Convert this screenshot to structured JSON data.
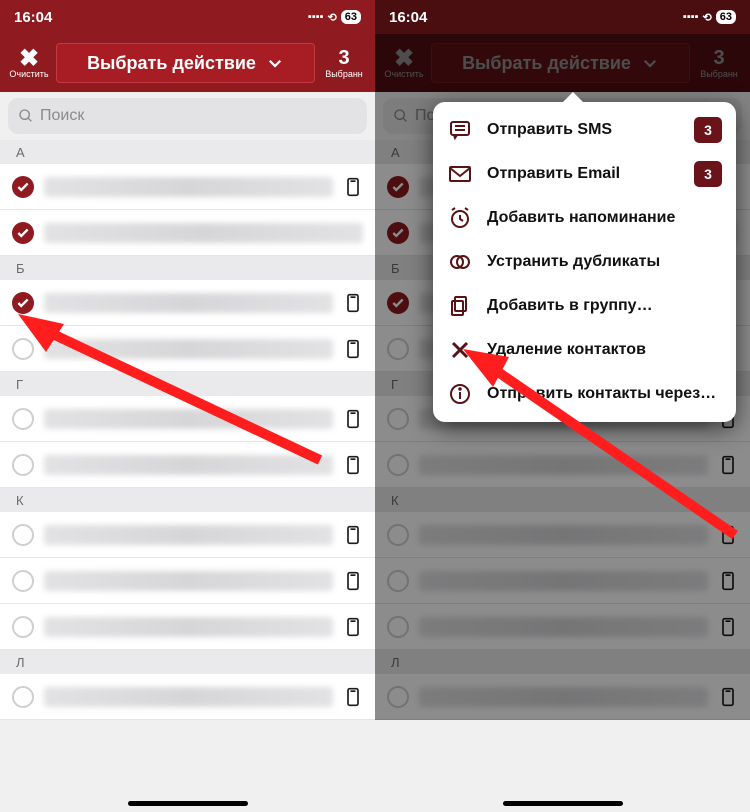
{
  "status": {
    "time": "16:04",
    "battery": "63"
  },
  "header": {
    "clear": "Очистить",
    "action": "Выбрать действие",
    "count": "3",
    "count_label": "Выбранн"
  },
  "search": {
    "placeholder": "Поиск"
  },
  "sections": {
    "a": "А",
    "b": "Б",
    "g": "Г",
    "k": "К",
    "l": "Л"
  },
  "popover": {
    "items": [
      {
        "label": "Отправить SMS",
        "badge": "3",
        "icon": "sms"
      },
      {
        "label": "Отправить Email",
        "badge": "3",
        "icon": "email"
      },
      {
        "label": "Добавить напоминание",
        "icon": "alarm"
      },
      {
        "label": "Устранить дубликаты",
        "icon": "dup"
      },
      {
        "label": "Добавить в группу…",
        "icon": "copy"
      },
      {
        "label": "Удаление контактов",
        "icon": "delete"
      },
      {
        "label": "Отправить контакты через…",
        "icon": "info"
      }
    ]
  }
}
